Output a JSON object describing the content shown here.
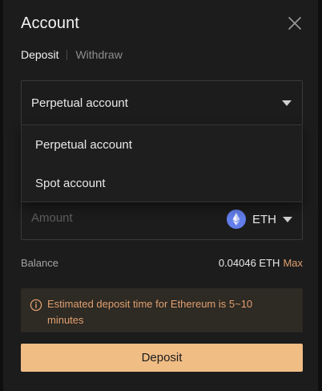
{
  "modal": {
    "title": "Account",
    "tabs": [
      {
        "label": "Deposit",
        "active": true
      },
      {
        "label": "Withdraw",
        "active": false
      }
    ]
  },
  "account_select": {
    "value": "Perpetual account",
    "options": [
      "Perpetual account",
      "Spot account"
    ]
  },
  "amount": {
    "placeholder": "Amount",
    "asset": "ETH",
    "asset_icon": "ethereum-icon"
  },
  "balance": {
    "label": "Balance",
    "value": "0.04046 ETH",
    "max_label": "Max"
  },
  "notice": {
    "icon": "info-icon",
    "text": "Estimated deposit time for Ethereum is 5~10 minutes"
  },
  "deposit_button": {
    "label": "Deposit"
  },
  "colors": {
    "background": "#1c1c1c",
    "accent": "#f0bd85",
    "notice_text": "#e0a070",
    "notice_bg": "#2e2a24",
    "eth": "#627eea"
  }
}
